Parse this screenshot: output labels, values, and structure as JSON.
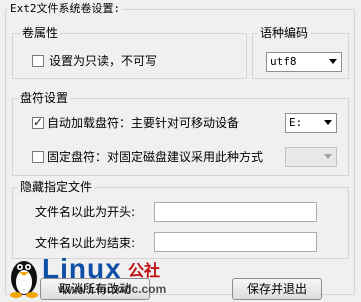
{
  "outer_group": {
    "title": "Ext2文件系统卷设置:"
  },
  "volume_props": {
    "title": "卷属性",
    "readonly_label": "设置为只读，不可写",
    "readonly_checked": false
  },
  "encoding": {
    "title": "语种编码",
    "selected": "utf8"
  },
  "drive_letter": {
    "title": "盘符设置",
    "auto_mount_label": "自动加载盘符：主要针对可移动设备",
    "auto_mount_checked": true,
    "auto_mount_drive": "E:",
    "fixed_label": "固定盘符：对固定磁盘建议采用此种方式",
    "fixed_checked": false,
    "fixed_drive": ""
  },
  "hidden_files": {
    "title": "隐藏指定文件",
    "prefix_label": "文件名以此为开头:",
    "prefix_value": "",
    "suffix_label": "文件名以此为结束:",
    "suffix_value": ""
  },
  "buttons": {
    "cancel_label": "取消所有改动",
    "save_label": "保存并退出"
  },
  "watermark": {
    "brand": "Linux",
    "suffix": "公社",
    "url": "www.Linuxidc.com"
  }
}
